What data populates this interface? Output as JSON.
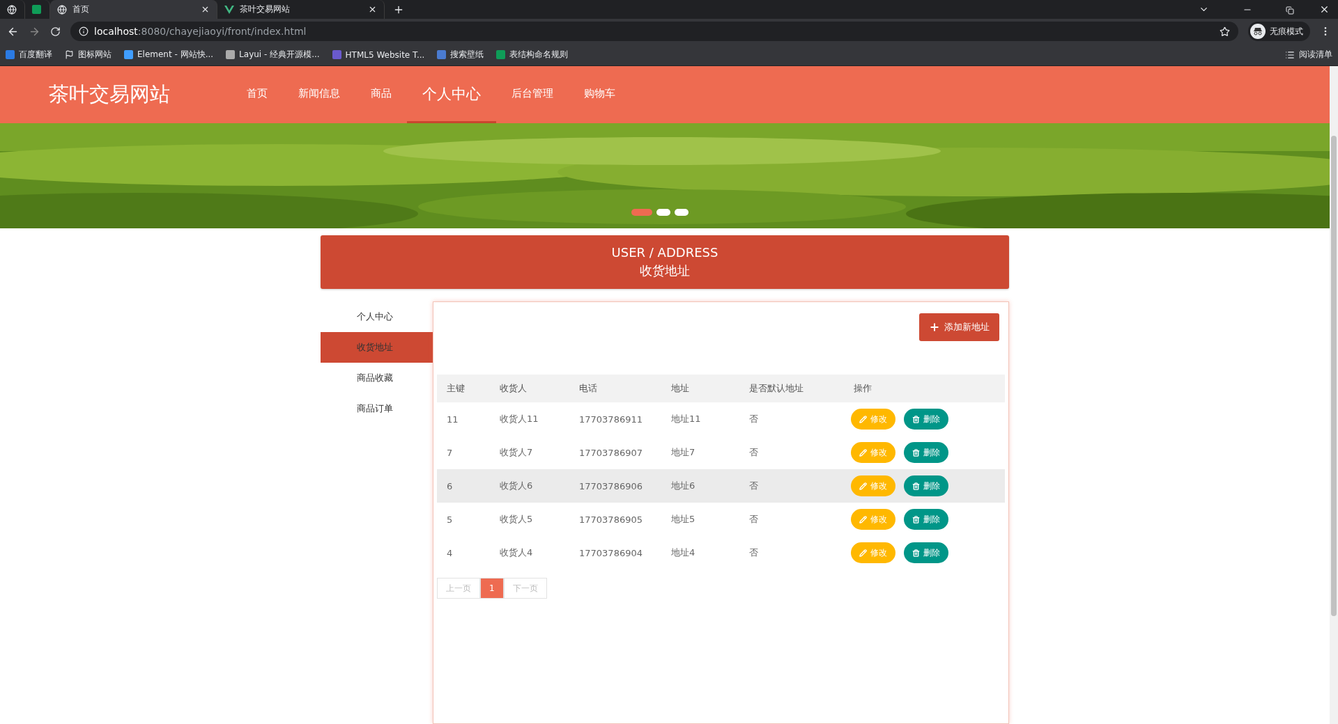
{
  "browser": {
    "tabs": [
      {
        "kind": "pinned",
        "selected": false
      },
      {
        "kind": "pinned-sheet",
        "selected": false
      },
      {
        "kind": "page",
        "title": "首页",
        "selected": true
      },
      {
        "kind": "vue",
        "title": "茶叶交易网站",
        "selected": false
      }
    ],
    "url_host": "localhost",
    "url_path": ":8080/chayejiaoyi/front/index.html",
    "incognito": "无痕模式",
    "bookmarks": [
      {
        "kind": "translate",
        "label": "百度翻译"
      },
      {
        "kind": "flag",
        "label": "图标网站"
      },
      {
        "kind": "element",
        "label": "Element - 网站快..."
      },
      {
        "kind": "layui",
        "label": "Layui - 经典开源模..."
      },
      {
        "kind": "html5",
        "label": "HTML5 Website T..."
      },
      {
        "kind": "u",
        "label": "搜索壁纸"
      },
      {
        "kind": "sheet",
        "label": "表结构命名规则"
      }
    ],
    "reading_list": "阅读清单"
  },
  "site": {
    "logo": "茶叶交易网站",
    "nav": [
      {
        "label": "首页",
        "selected": false
      },
      {
        "label": "新闻信息",
        "selected": false
      },
      {
        "label": "商品",
        "selected": false
      },
      {
        "label": "个人中心",
        "selected": true
      },
      {
        "label": "后台管理",
        "selected": false
      },
      {
        "label": "购物车",
        "selected": false
      }
    ],
    "carousel": [
      {
        "selected": true
      },
      {
        "selected": false
      },
      {
        "selected": false
      }
    ]
  },
  "page_title": {
    "en": "USER / ADDRESS",
    "zh": "收货地址"
  },
  "sidebar": {
    "items": [
      {
        "label": "个人中心",
        "selected": false
      },
      {
        "label": "收货地址",
        "selected": true
      },
      {
        "label": "商品收藏",
        "selected": false
      },
      {
        "label": "商品订单",
        "selected": false
      }
    ]
  },
  "add_button": "添加新地址",
  "table": {
    "columns": [
      "主键",
      "收货人",
      "电话",
      "地址",
      "是否默认地址",
      "操作"
    ],
    "rows": [
      {
        "cells": [
          "11",
          "收货人11",
          "17703786911",
          "地址11",
          "否"
        ],
        "highlighted": false,
        "edit": "修改",
        "delete": "删除"
      },
      {
        "cells": [
          "7",
          "收货人7",
          "17703786907",
          "地址7",
          "否"
        ],
        "highlighted": false,
        "edit": "修改",
        "delete": "删除"
      },
      {
        "cells": [
          "6",
          "收货人6",
          "17703786906",
          "地址6",
          "否"
        ],
        "highlighted": true,
        "edit": "修改",
        "delete": "删除"
      },
      {
        "cells": [
          "5",
          "收货人5",
          "17703786905",
          "地址5",
          "否"
        ],
        "highlighted": false,
        "edit": "修改",
        "delete": "删除"
      },
      {
        "cells": [
          "4",
          "收货人4",
          "17703786904",
          "地址4",
          "否"
        ],
        "highlighted": false,
        "edit": "修改",
        "delete": "删除"
      }
    ]
  },
  "pagination": {
    "prev": "上一页",
    "pages": [
      {
        "label": "1",
        "selected": true
      }
    ],
    "next": "下一页"
  }
}
